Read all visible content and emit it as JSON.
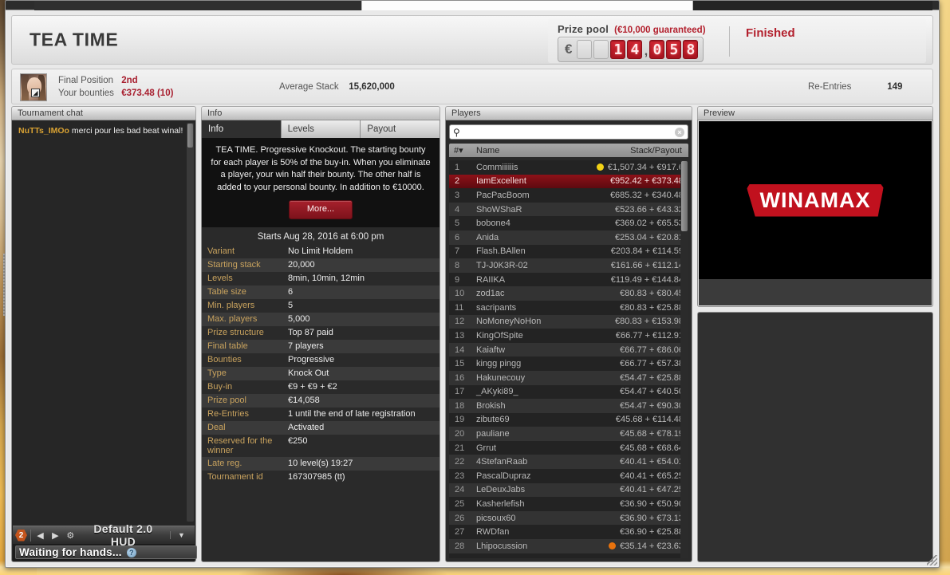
{
  "window": {
    "title": "TEA TIME",
    "tabstrip_note": "partial-browser-tabs"
  },
  "header": {
    "tourney_title": "TEA TIME",
    "prize_pool_label": "Prize pool",
    "prize_pool_guarantee": "(€10,000 guaranteed)",
    "prize_pool_currency": "€",
    "prize_pool_digits": [
      "",
      "",
      "1",
      "4",
      "0",
      "5",
      "8"
    ],
    "prize_pool_value": "€14,058",
    "status": "Finished",
    "accent_red": "#b3212e",
    "lcd_red": "#cf2430"
  },
  "stats": {
    "final_position_label": "Final Position",
    "final_position_value": "2nd",
    "bounties_label": "Your bounties",
    "bounties_value": "€373.48 (10)",
    "avg_stack_label": "Average Stack",
    "avg_stack_value": "15,620,000",
    "reentries_label": "Re-Entries",
    "reentries_value": "149"
  },
  "chat": {
    "panel_title": "Tournament chat",
    "messages": [
      {
        "nick": "NuTTs_IMOo",
        "text": "merci pour les bad beat winal!"
      }
    ]
  },
  "hud": {
    "badge": "2",
    "prev_icon": "◀",
    "next_icon": "▶",
    "gear_icon": "⚙",
    "profile_name": "Default 2.0 HUD",
    "caret_icon": "▼",
    "status": "Waiting for hands...",
    "help_icon": "?"
  },
  "info": {
    "panel_title": "Info",
    "tabs": [
      {
        "label": "Info",
        "active": true
      },
      {
        "label": "Levels",
        "active": false
      },
      {
        "label": "Payout",
        "active": false
      }
    ],
    "blurb": "TEA TIME. Progressive Knockout. The starting bounty for each player is 50% of the buy-in. When you eliminate a player, your win half their bounty. The other half is added to your personal bounty. In addition to €10000.",
    "more_label": "More...",
    "starts": "Starts Aug 28, 2016 at 6:00 pm",
    "rows": [
      {
        "k": "Variant",
        "v": "No Limit Holdem"
      },
      {
        "k": "Starting stack",
        "v": "20,000"
      },
      {
        "k": "Levels",
        "v": "8min, 10min, 12min"
      },
      {
        "k": "Table size",
        "v": "6"
      },
      {
        "k": "Min. players",
        "v": "5"
      },
      {
        "k": "Max. players",
        "v": "5,000"
      },
      {
        "k": "Prize structure",
        "v": "Top 87 paid"
      },
      {
        "k": "Final table",
        "v": "7 players"
      },
      {
        "k": "Bounties",
        "v": "Progressive"
      },
      {
        "k": "Type",
        "v": "Knock Out"
      },
      {
        "k": "Buy-in",
        "v": "€9 + €9 + €2"
      },
      {
        "k": "Prize pool",
        "v": "€14,058"
      },
      {
        "k": "Re-Entries",
        "v": "1 until the end of late registration"
      },
      {
        "k": "Deal",
        "v": "Activated"
      },
      {
        "k": "Reserved for the winner",
        "v": "€250"
      },
      {
        "k": "Late reg.",
        "v": "10 level(s) 19:27"
      },
      {
        "k": "Tournament id",
        "v": "167307985 (tt)"
      }
    ]
  },
  "players": {
    "panel_title": "Players",
    "search_value": "",
    "search_placeholder": "",
    "search_icon": "search-icon",
    "clear_icon": "×",
    "columns": {
      "num": "#▾",
      "name": "Name",
      "stack": "Stack/Payout"
    },
    "rows": [
      {
        "num": "1",
        "name": "Commiiiiiis",
        "stack": "€1,507.34 + €917.6",
        "dot": "#f2d216"
      },
      {
        "num": "2",
        "name": "IamExcellent",
        "stack": "€952.42 + €373.48",
        "me": true
      },
      {
        "num": "3",
        "name": "PacPacBoom",
        "stack": "€685.32 + €340.48"
      },
      {
        "num": "4",
        "name": "ShoWShaR",
        "stack": "€523.66 + €43.32"
      },
      {
        "num": "5",
        "name": "bobone4",
        "stack": "€369.02 + €65.53"
      },
      {
        "num": "6",
        "name": "Anida",
        "stack": "€253.04 + €20.81"
      },
      {
        "num": "7",
        "name": "Flash.BAllen",
        "stack": "€203.84 + €114.59"
      },
      {
        "num": "8",
        "name": "TJ-J0K3R-02",
        "stack": "€161.66 + €112.14"
      },
      {
        "num": "9",
        "name": "RAIIKA",
        "stack": "€119.49 + €144.84"
      },
      {
        "num": "10",
        "name": "zod1ac",
        "stack": "€80.83 + €80.45"
      },
      {
        "num": "11",
        "name": "sacripants",
        "stack": "€80.83 + €25.88"
      },
      {
        "num": "12",
        "name": "NoMoneyNoHon",
        "stack": "€80.83 + €153.98"
      },
      {
        "num": "13",
        "name": "KingOfSpite",
        "stack": "€66.77 + €112.91"
      },
      {
        "num": "14",
        "name": "Kaiaftw",
        "stack": "€66.77 + €86.06"
      },
      {
        "num": "15",
        "name": "kingg pingg",
        "stack": "€66.77 + €57.38"
      },
      {
        "num": "16",
        "name": "Hakunecouy",
        "stack": "€54.47 + €25.88"
      },
      {
        "num": "17",
        "name": "_AKyki89_",
        "stack": "€54.47 + €40.50"
      },
      {
        "num": "18",
        "name": "Brokish",
        "stack": "€54.47 + €90.30"
      },
      {
        "num": "19",
        "name": "zibute69",
        "stack": "€45.68 + €114.48"
      },
      {
        "num": "20",
        "name": "pauliane",
        "stack": "€45.68 + €78.19"
      },
      {
        "num": "21",
        "name": "Grrut",
        "stack": "€45.68 + €68.64"
      },
      {
        "num": "22",
        "name": "4StefanRaab",
        "stack": "€40.41 + €54.01"
      },
      {
        "num": "23",
        "name": "PascalDupraz",
        "stack": "€40.41 + €65.25"
      },
      {
        "num": "24",
        "name": "LeDeuxJabs",
        "stack": "€40.41 + €47.25"
      },
      {
        "num": "25",
        "name": "Kasherlefish",
        "stack": "€36.90 + €50.90"
      },
      {
        "num": "26",
        "name": "picsoux60",
        "stack": "€36.90 + €73.13"
      },
      {
        "num": "27",
        "name": "RWDfan",
        "stack": "€36.90 + €25.88"
      },
      {
        "num": "28",
        "name": "Lhipocussion",
        "stack": "€35.14 + €23.63",
        "dot": "#e8720d"
      }
    ]
  },
  "preview": {
    "panel_title": "Preview",
    "logo_text": "WINAMAX",
    "logo_color": "#c1111e"
  }
}
